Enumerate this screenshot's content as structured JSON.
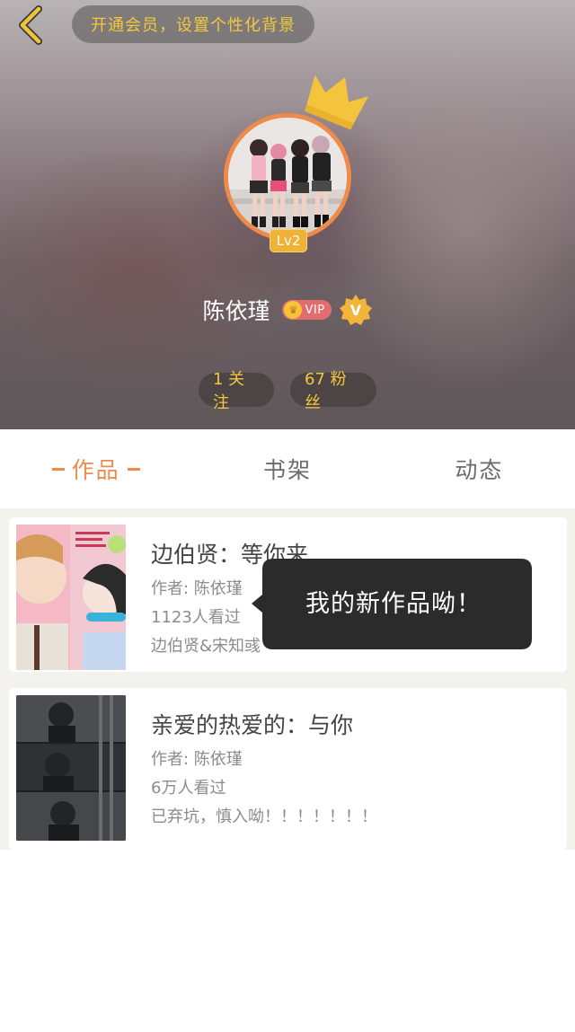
{
  "header": {
    "vip_banner": "开通会员，设置个性化背景",
    "level": "Lv2",
    "username": "陈依瑾",
    "vip_label": "VIP",
    "verified_label": "V",
    "following": "1 关注",
    "followers": "67 粉丝"
  },
  "tabs": [
    {
      "label": "作品",
      "active": true
    },
    {
      "label": "书架",
      "active": false
    },
    {
      "label": "动态",
      "active": false
    }
  ],
  "works": [
    {
      "title": "边伯贤：等你来",
      "author": "作者: 陈依瑾",
      "views": "1123人看过",
      "tags": "边伯贤&宋知彧"
    },
    {
      "title": "亲爱的热爱的：与你",
      "author": "作者: 陈依瑾",
      "views": "6万人看过",
      "tags": "已弃坑，慎入呦！！！！！！！"
    }
  ],
  "tooltip": "我的新作品呦！",
  "colors": {
    "accent": "#ec8c4c",
    "gold": "#f3c93a",
    "tooltip_bg": "#2b2b2b"
  }
}
